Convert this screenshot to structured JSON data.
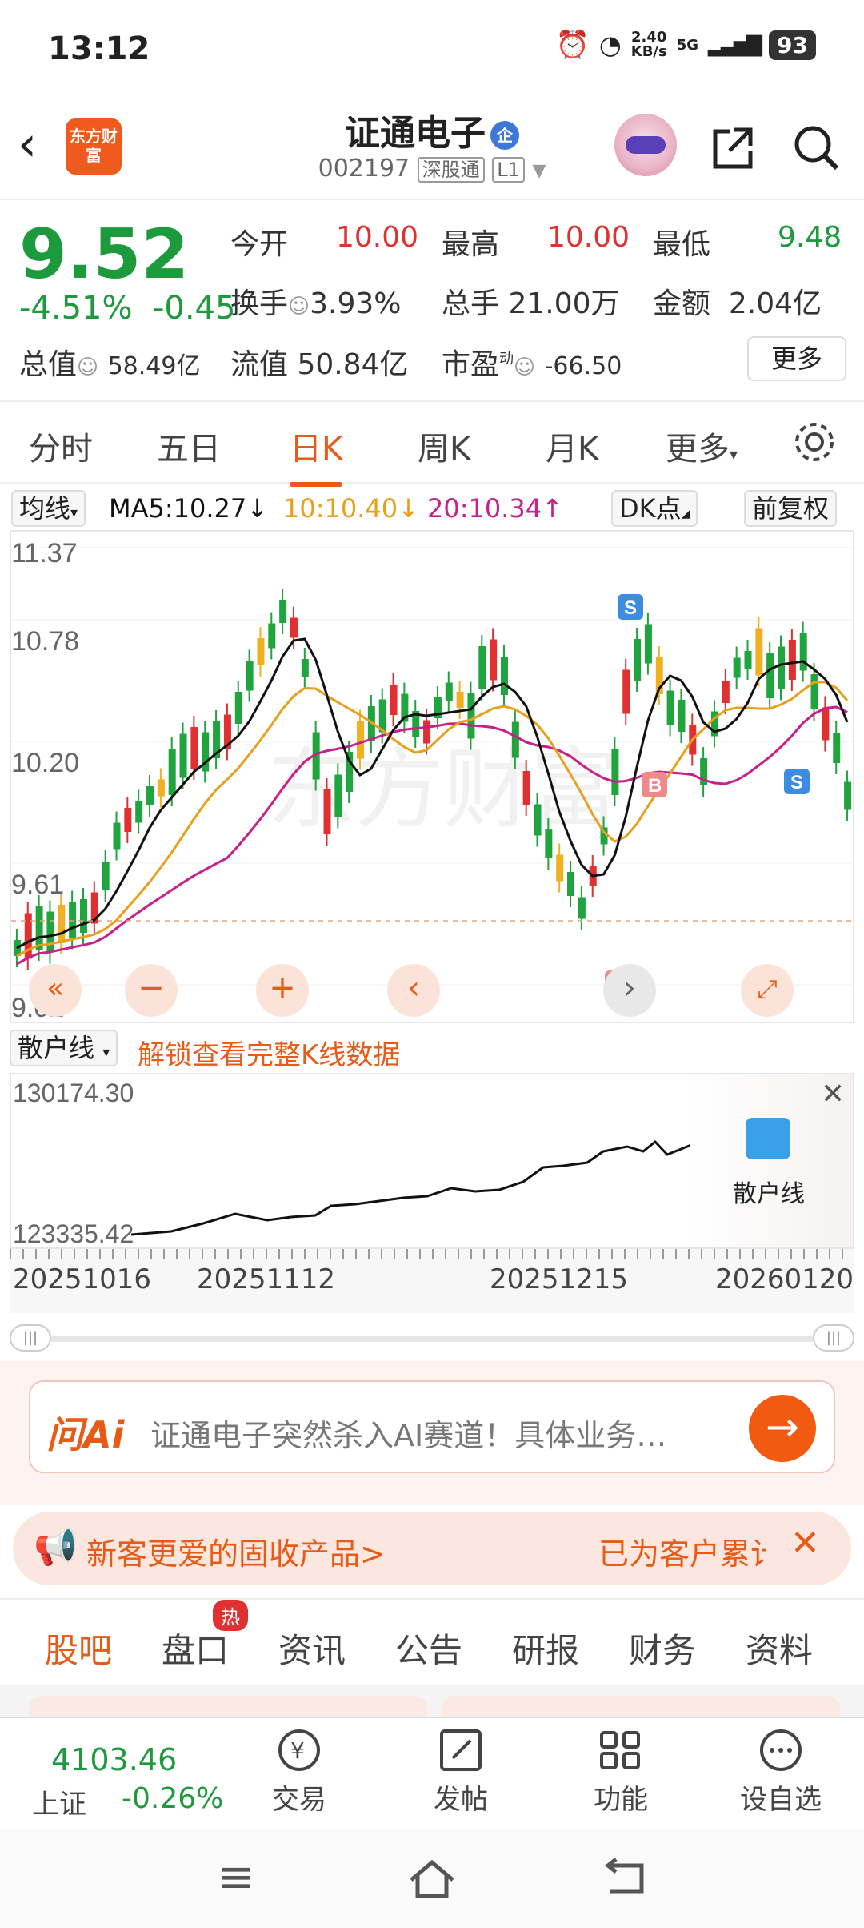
{
  "status": {
    "time": "13:12",
    "net_speed": "2.40",
    "net_unit": "KB/s",
    "signal": "5G",
    "battery": "93"
  },
  "header": {
    "logo": "东方财富",
    "stock_name": "证通电子",
    "badge": "企",
    "code": "002197",
    "tag1": "深股通",
    "tag2": "L1"
  },
  "quote": {
    "price": "9.52",
    "change_pct": "-4.51%",
    "change": "-0.45",
    "open_label": "今开",
    "open": "10.00",
    "high_label": "最高",
    "high": "10.00",
    "low_label": "最低",
    "low": "9.48",
    "turnover_label": "换手",
    "turnover": "3.93%",
    "volume_label": "总手",
    "volume": "21.00万",
    "amount_label": "金额",
    "amount": "2.04亿",
    "mcap_label": "总值",
    "mcap": "58.49亿",
    "float_label": "流值",
    "float": "50.84亿",
    "pe_label": "市盈",
    "pe_sup": "动",
    "pe": "-66.50",
    "more": "更多"
  },
  "tabs": [
    "分时",
    "五日",
    "日K",
    "周K",
    "月K",
    "更多"
  ],
  "ma": {
    "selector": "均线",
    "ma5": "MA5:10.27",
    "ma10": "10:10.40",
    "ma20": "20:10.34",
    "dk": "DK点",
    "adjust": "前复权"
  },
  "chart": {
    "y_labels": [
      "11.37",
      "10.78",
      "10.20",
      "9.61",
      "9.02"
    ],
    "watermark": "东方财富"
  },
  "retail": {
    "selector": "散户线",
    "unlock": "解锁查看完整K线数据",
    "max": "130174.30",
    "min": "123335.42",
    "promo": "散户线",
    "dates": [
      "20251016",
      "20251112",
      "20251215",
      "20260120"
    ]
  },
  "ai": {
    "logo": "问Ai",
    "text": "证通电子突然杀入AI赛道！具体业务…"
  },
  "banner": {
    "left": "新客更爱的固收产品>",
    "right": "已为客户累计"
  },
  "subtabs": [
    "股吧",
    "盘口",
    "资讯",
    "公告",
    "研报",
    "财务",
    "资料"
  ],
  "hot": "热",
  "bottom": {
    "index_value": "4103.46",
    "index_name": "上证",
    "index_change": "-0.26%",
    "trade": "交易",
    "post": "发帖",
    "func": "功能",
    "watch": "设自选"
  },
  "colors": {
    "accent": "#e85a16",
    "up": "#e03030",
    "down": "#1d9a3c",
    "ma5": "#111111",
    "ma10": "#e8a01c",
    "ma20": "#c8208a"
  }
}
